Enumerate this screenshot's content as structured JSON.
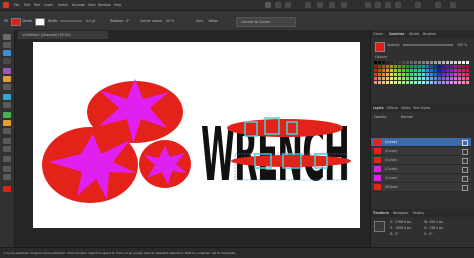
{
  "menu": [
    "File",
    "Edit",
    "Text",
    "Layer",
    "Select",
    "Arrange",
    "View",
    "Window",
    "Help"
  ],
  "context": {
    "fill_label": "Fill",
    "stroke_label": "Stroke",
    "width_label": "Width:",
    "width_value": "0.0 pt",
    "rotation_label": "Rotation:",
    "rotation_value": "0°",
    "corner_label": "Corner radius:",
    "corner_value": "50 %",
    "size_label": "Size:",
    "size_value": "160px",
    "convert_button": "Convert to Curves",
    "fill_color": "#e02018",
    "stroke_color": "#ffffff"
  },
  "document_tab": "<Untitled> (Unsaved) (56.0%)",
  "canvas": {
    "wrench_text": "WRENCH",
    "red": "#e3231a",
    "magenta": "#e020f0",
    "cyan": "#3cd8e0"
  },
  "right_panel": {
    "tabs_top": [
      "Colour",
      "Swatches",
      "Stroke",
      "Brushes"
    ],
    "swatch_palette_label": "Colours",
    "opacity_label": "Opacity:",
    "opacity_value": "100 %",
    "layer_tabs": [
      "Layers",
      "Effects",
      "Styles",
      "Text Styles"
    ],
    "blend_label": "Opacity:",
    "blend_value": "Normal",
    "layers": [
      {
        "name": "(Curve)",
        "selected": true
      },
      {
        "name": "(Curve)",
        "selected": false
      },
      {
        "name": "(Curve)",
        "selected": false
      },
      {
        "name": "(Curve)",
        "selected": false
      },
      {
        "name": "(Curve)",
        "selected": false
      },
      {
        "name": "(Ellipse)",
        "selected": false
      }
    ],
    "transform_tabs": [
      "Transform",
      "Navigator",
      "History"
    ],
    "transform": {
      "x_label": "X:",
      "x_value": "1766.8 px",
      "y_label": "Y:",
      "y_value": "1008.3 px",
      "w_label": "W:",
      "w_value": "349.2 px",
      "h_label": "H:",
      "h_value": "138.4 px",
      "r_label": "R:",
      "r_value": "0°",
      "s_label": "S:",
      "s_value": "0°"
    }
  },
  "status": "1 Curve selected. Drag to move selection. Click another object to select it. Click on an empty area to deselect selection. Shift to constrain. Alt to duplicate."
}
